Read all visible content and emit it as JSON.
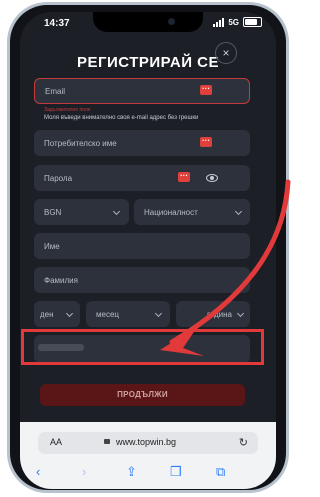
{
  "status": {
    "time": "14:37",
    "network": "5G"
  },
  "form": {
    "title": "РЕГИСТРИРАЙ СЕ",
    "close": "×",
    "email_placeholder": "Email",
    "required": "Задължително поле",
    "email_hint": "Моля въведи внимателно своя e-mail адрес без грешки",
    "username_placeholder": "Потребителско име",
    "password_placeholder": "Парола",
    "currency": "BGN",
    "nationality": "Националност",
    "first_name": "Име",
    "last_name": "Фамилия",
    "day": "ден",
    "month": "месец",
    "year": "година",
    "continue": "ПРОДЪЛЖИ"
  },
  "browser": {
    "aa": "AA",
    "url": "www.topwin.bg"
  },
  "icons": [
    "dots-icon",
    "eye-icon",
    "close-icon",
    "chevron-down-icon",
    "lock-icon",
    "reload-icon",
    "back-icon",
    "forward-icon",
    "share-icon",
    "book-icon",
    "tabs-icon"
  ],
  "colors": {
    "accent": "#e0403c",
    "annotation": "#e23a3a"
  }
}
